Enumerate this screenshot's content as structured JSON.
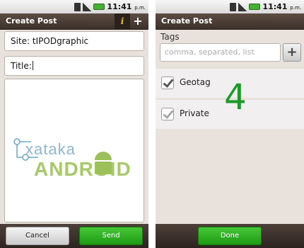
{
  "status_bar": {
    "time": "11:41",
    "ampm": "p.m."
  },
  "create_screen": {
    "title": "Create Post",
    "site_field": "Site: tIPODgraphic",
    "title_field_label": "Title:",
    "cancel_label": "Cancel",
    "send_label": "Send",
    "info_label": "i",
    "add_label": "+"
  },
  "tags_screen": {
    "title": "Create Post",
    "tags_label": "Tags",
    "tags_placeholder": "comma, separated, list",
    "geotag_label": "Geotag",
    "geotag_checked": true,
    "private_label": "Private",
    "private_checked": true,
    "done_label": "Done",
    "step_number": "4"
  },
  "watermark": {
    "line1": "xataka",
    "line2": "ANDROID"
  }
}
